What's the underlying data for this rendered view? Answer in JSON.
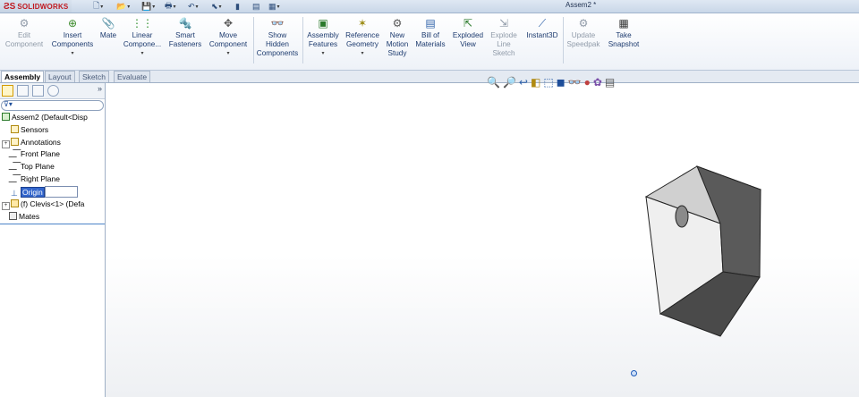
{
  "app": {
    "logo_text": "SOLIDWORKS",
    "doc_title": "Assem2 *"
  },
  "quick_access": [
    {
      "icon": "new-document-icon"
    },
    {
      "icon": "open-folder-icon"
    },
    {
      "icon": "save-icon"
    },
    {
      "icon": "print-icon"
    },
    {
      "icon": "undo-icon"
    },
    {
      "icon": "select-cursor-icon"
    },
    {
      "icon": "rebuild-icon"
    },
    {
      "icon": "file-properties-icon"
    },
    {
      "icon": "options-icon"
    }
  ],
  "commands": [
    {
      "label": "Edit\nComponent",
      "icon": "edit-component-icon",
      "enabled": false
    },
    {
      "label": "Insert\nComponents",
      "icon": "insert-components-icon",
      "enabled": true
    },
    {
      "label": "Mate",
      "icon": "mate-icon",
      "enabled": true
    },
    {
      "label": "Linear\nCompone...",
      "icon": "linear-pattern-icon",
      "enabled": true
    },
    {
      "label": "Smart\nFasteners",
      "icon": "smart-fasteners-icon",
      "enabled": true
    },
    {
      "label": "Move\nComponent",
      "icon": "move-component-icon",
      "enabled": true
    },
    {
      "label": "Show\nHidden\nComponents",
      "icon": "show-hidden-icon",
      "enabled": true
    },
    {
      "label": "Assembly\nFeatures",
      "icon": "assembly-features-icon",
      "enabled": true
    },
    {
      "label": "Reference\nGeometry",
      "icon": "reference-geometry-icon",
      "enabled": true
    },
    {
      "label": "New\nMotion\nStudy",
      "icon": "motion-study-icon",
      "enabled": true
    },
    {
      "label": "Bill of\nMaterials",
      "icon": "bill-of-materials-icon",
      "enabled": true
    },
    {
      "label": "Exploded\nView",
      "icon": "exploded-view-icon",
      "enabled": true
    },
    {
      "label": "Explode\nLine\nSketch",
      "icon": "explode-line-icon",
      "enabled": false
    },
    {
      "label": "Instant3D",
      "icon": "instant3d-icon",
      "enabled": true
    },
    {
      "label": "Update\nSpeedpak",
      "icon": "speedpak-icon",
      "enabled": false
    },
    {
      "label": "Take\nSnapshot",
      "icon": "snapshot-icon",
      "enabled": true
    }
  ],
  "tabs": [
    "Assembly",
    "Layout",
    "Sketch",
    "Evaluate"
  ],
  "feature_tree": [
    {
      "label": "Assem2  (Default<Disp",
      "icon": "assembly-icon",
      "expander": ""
    },
    {
      "label": "Sensors",
      "icon": "sensors-icon",
      "expander": ""
    },
    {
      "label": "Annotations",
      "icon": "annotations-icon",
      "expander": "+"
    },
    {
      "label": "Front Plane",
      "icon": "plane-icon",
      "expander": ""
    },
    {
      "label": "Top Plane",
      "icon": "plane-icon",
      "expander": ""
    },
    {
      "label": "Right Plane",
      "icon": "plane-icon",
      "expander": ""
    },
    {
      "label": "Origin",
      "icon": "origin-icon",
      "expander": ""
    },
    {
      "label": "(f) Clevis<1> (Defa",
      "icon": "part-icon",
      "expander": "+"
    },
    {
      "label": "Mates",
      "icon": "mates-icon",
      "expander": ""
    }
  ],
  "heads_up_toolbar": [
    "zoom-to-fit-icon",
    "zoom-to-area-icon",
    "previous-view-icon",
    "section-view-icon",
    "view-orientation-icon",
    "display-style-icon",
    "hide-show-items-icon",
    "edit-appearance-icon",
    "apply-scene-icon",
    "view-settings-icon"
  ],
  "colors": {
    "accent": "#3366cc",
    "brand_red": "#c0181f",
    "part_face": "#4a4a4a",
    "part_side": "#dcdcdc"
  }
}
